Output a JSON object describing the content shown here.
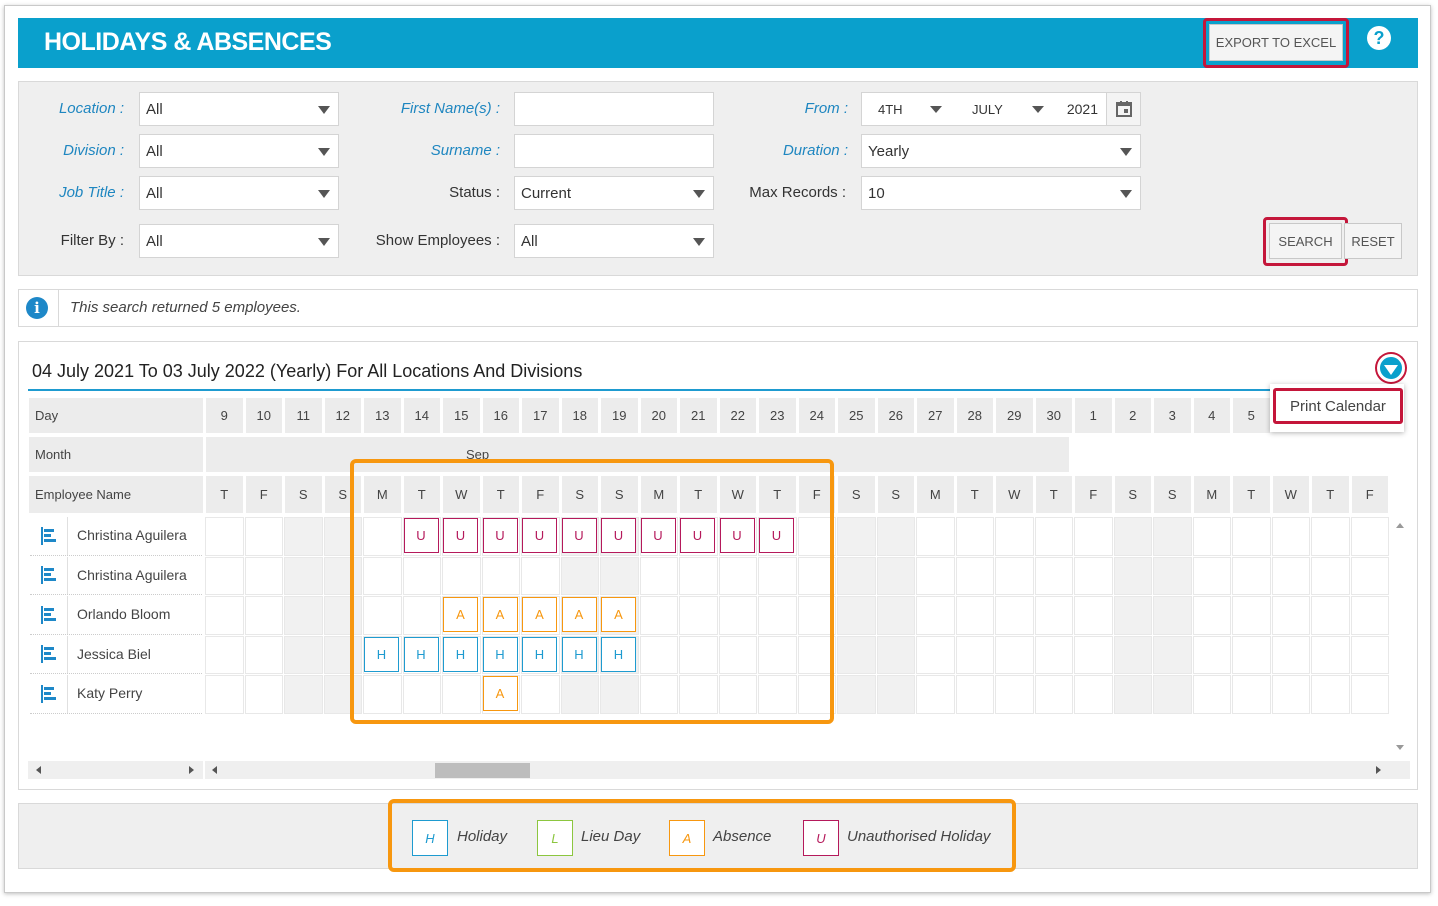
{
  "header": {
    "title": "HOLIDAYS & ABSENCES",
    "export_label": "EXPORT TO EXCEL",
    "help_glyph": "?"
  },
  "filters": {
    "location": {
      "label": "Location :",
      "value": "All"
    },
    "division": {
      "label": "Division :",
      "value": "All"
    },
    "job_title": {
      "label": "Job Title :",
      "value": "All"
    },
    "filter_by": {
      "label": "Filter By :",
      "value": "All"
    },
    "first_names": {
      "label": "First Name(s) :",
      "value": ""
    },
    "surname": {
      "label": "Surname :",
      "value": ""
    },
    "status": {
      "label": "Status :",
      "value": "Current"
    },
    "show_employees": {
      "label": "Show Employees :",
      "value": "All"
    },
    "from": {
      "label": "From :",
      "day": "4TH",
      "month": "JULY",
      "year": "2021"
    },
    "duration": {
      "label": "Duration :",
      "value": "Yearly"
    },
    "max_records": {
      "label": "Max Records :",
      "value": "10"
    },
    "search_label": "SEARCH",
    "reset_label": "RESET"
  },
  "info": {
    "icon": "i",
    "text": "This search returned 5 employees."
  },
  "calendar": {
    "title": "04 July 2021 To 03 July 2022 (Yearly) For All Locations And Divisions",
    "print_label": "Print Calendar",
    "day_header": "Day",
    "month_header": "Month",
    "employee_header": "Employee Name",
    "month_label": "Sep",
    "days": [
      "9",
      "10",
      "11",
      "12",
      "13",
      "14",
      "15",
      "16",
      "17",
      "18",
      "19",
      "20",
      "21",
      "22",
      "23",
      "24",
      "25",
      "26",
      "27",
      "28",
      "29",
      "30",
      "1",
      "2",
      "3",
      "4",
      "5"
    ],
    "weekdays": [
      "T",
      "F",
      "S",
      "S",
      "M",
      "T",
      "W",
      "T",
      "F",
      "S",
      "S",
      "M",
      "T",
      "W",
      "T",
      "F",
      "S",
      "S",
      "M",
      "T",
      "W",
      "T",
      "F",
      "S",
      "S",
      "M",
      "T",
      "W",
      "T",
      "F"
    ],
    "weekend_cols": [
      2,
      3,
      9,
      10,
      16,
      17,
      23,
      24
    ],
    "employees": [
      {
        "name": "Christina Aguilera",
        "marks": [
          {
            "col": 5,
            "type": "U"
          },
          {
            "col": 6,
            "type": "U"
          },
          {
            "col": 7,
            "type": "U"
          },
          {
            "col": 8,
            "type": "U"
          },
          {
            "col": 9,
            "type": "U"
          },
          {
            "col": 10,
            "type": "U"
          },
          {
            "col": 11,
            "type": "U"
          },
          {
            "col": 12,
            "type": "U"
          },
          {
            "col": 13,
            "type": "U"
          },
          {
            "col": 14,
            "type": "U"
          }
        ]
      },
      {
        "name": "Christina Aguilera",
        "marks": []
      },
      {
        "name": "Orlando Bloom",
        "marks": [
          {
            "col": 6,
            "type": "A"
          },
          {
            "col": 7,
            "type": "A"
          },
          {
            "col": 8,
            "type": "A"
          },
          {
            "col": 9,
            "type": "A"
          },
          {
            "col": 10,
            "type": "A"
          }
        ]
      },
      {
        "name": "Jessica Biel",
        "marks": [
          {
            "col": 4,
            "type": "H"
          },
          {
            "col": 5,
            "type": "H"
          },
          {
            "col": 6,
            "type": "H"
          },
          {
            "col": 7,
            "type": "H"
          },
          {
            "col": 8,
            "type": "H"
          },
          {
            "col": 9,
            "type": "H"
          },
          {
            "col": 10,
            "type": "H"
          }
        ]
      },
      {
        "name": "Katy Perry",
        "marks": [
          {
            "col": 7,
            "type": "A"
          }
        ]
      }
    ]
  },
  "legend": [
    {
      "code": "H",
      "label": "Holiday",
      "color": "#1e9bd0"
    },
    {
      "code": "L",
      "label": "Lieu Day",
      "color": "#8cc63f"
    },
    {
      "code": "A",
      "label": "Absence",
      "color": "#f7970f"
    },
    {
      "code": "U",
      "label": "Unauthorised Holiday",
      "color": "#b5195b"
    }
  ],
  "colors": {
    "H": "#1e9bd0",
    "L": "#8cc63f",
    "A": "#f7970f",
    "U": "#b5195b",
    "brand": "#0aa0cc",
    "highlight": "#c4163a",
    "callout": "#f7970f"
  }
}
